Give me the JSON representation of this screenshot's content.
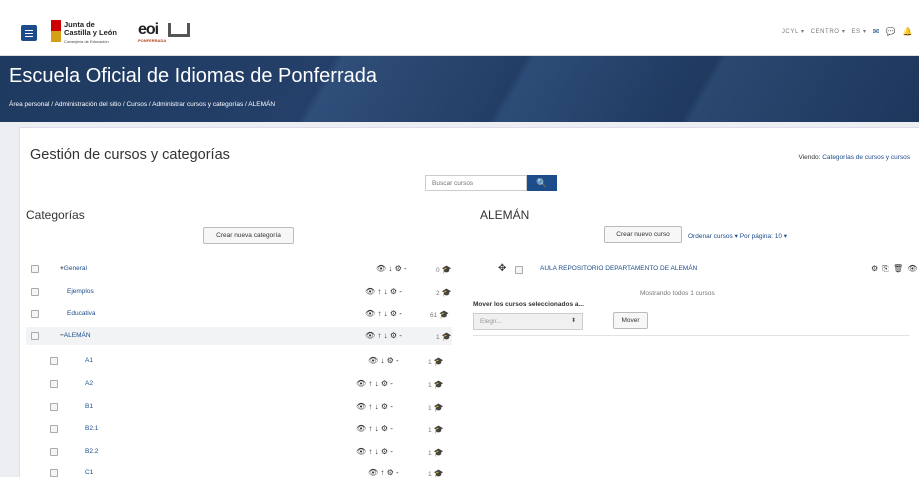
{
  "header": {
    "logo_line1": "Junta de",
    "logo_line2": "Castilla y León",
    "logo_sub": "Consejería de Educación",
    "eoi_text": "eoi",
    "eoi_sub": "PONFERRADA",
    "nav": [
      "JCYL",
      "CENTRO",
      "ES"
    ],
    "caret": "▾"
  },
  "hero": {
    "title": "Escuela Oficial de Idiomas de Ponferrada",
    "breadcrumbs": [
      "Área personal",
      "Administración del sitio",
      "Cursos",
      "Administrar cursos y categorías",
      "ALEMÁN"
    ],
    "separator": "/"
  },
  "main": {
    "title": "Gestión de cursos y categorías",
    "viewing_label": "Viendo:",
    "viewing_value": "Categorías de cursos y cursos",
    "search_placeholder": "Buscar cursos",
    "search_icon": "search-icon"
  },
  "categories": {
    "title": "Categorías",
    "create_button": "Crear nueva categoría",
    "items": [
      {
        "label": "General",
        "prefix": "+",
        "actions": "👁 ↓ ⚙ -",
        "count": "0"
      },
      {
        "label": "Ejemplos",
        "prefix": "",
        "actions": "👁 ↑ ↓ ⚙ -",
        "count": "2"
      },
      {
        "label": "Educativa",
        "prefix": "",
        "actions": "👁 ↑ ↓ ⚙ -",
        "count": "61"
      },
      {
        "label": "ALEMÁN",
        "prefix": "−",
        "actions": "👁 ↑ ↓ ⚙ -",
        "count": "1"
      },
      {
        "label": "A1",
        "prefix": "",
        "actions": "👁 ↓ ⚙ -",
        "count": "1"
      },
      {
        "label": "A2",
        "prefix": "",
        "actions": "👁 ↑ ↓ ⚙ -",
        "count": "1"
      },
      {
        "label": "B1",
        "prefix": "",
        "actions": "👁 ↑ ↓ ⚙ -",
        "count": "1"
      },
      {
        "label": "B2.1",
        "prefix": "",
        "actions": "👁 ↑ ↓ ⚙ -",
        "count": "1"
      },
      {
        "label": "B2.2",
        "prefix": "",
        "actions": "👁 ↑ ↓ ⚙ -",
        "count": "1"
      },
      {
        "label": "C1",
        "prefix": "",
        "actions": "👁 ↑ ⚙ -",
        "count": "1"
      }
    ]
  },
  "courses": {
    "title": "ALEMÁN",
    "create_button": "Crear nuevo curso",
    "sort_label": "Ordenar cursos",
    "per_page_label": "Por página: 10",
    "items": [
      {
        "name": "AULA REPOSITORIO DEPARTAMENTO DE ALEMÁN",
        "actions": "⚙ ⎘ 🗑 👁"
      }
    ],
    "showing": "Mostrando todos 1 cursos",
    "move_label": "Mover los cursos seleccionados a...",
    "select_placeholder": "Elegir...",
    "move_button": "Mover"
  }
}
